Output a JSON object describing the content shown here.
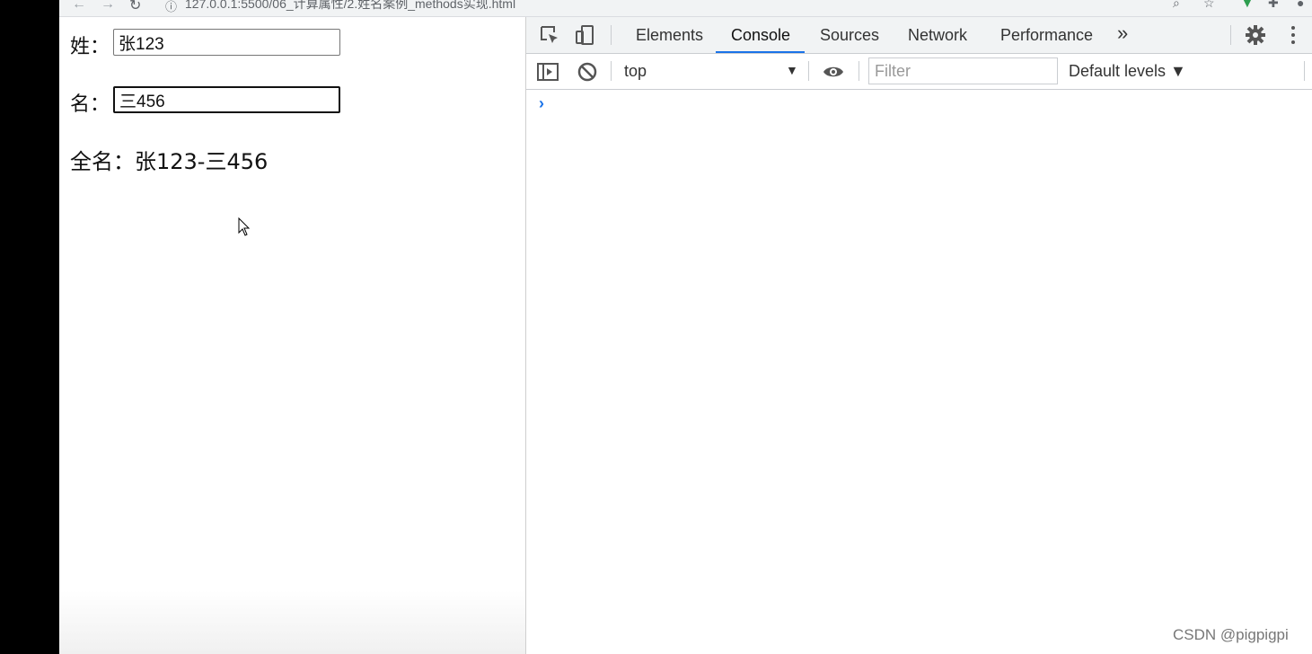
{
  "browser": {
    "url": "127.0.0.1:5500/06_计算属性/2.姓名案例_methods实现.html"
  },
  "page": {
    "last_name_label": "姓：",
    "last_name_value": "张123",
    "first_name_label": "名：",
    "first_name_value": "三456",
    "full_name_text": "全名：张123-三456"
  },
  "devtools": {
    "tabs": [
      "Elements",
      "Console",
      "Sources",
      "Network",
      "Performance"
    ],
    "active_tab": "Console",
    "more_tabs": "»",
    "context": "top",
    "filter_placeholder": "Filter",
    "levels": "Default levels ▼",
    "prompt_symbol": "›"
  },
  "watermark": "CSDN @pigpigpi",
  "colors": {
    "accent": "#1a73e8"
  }
}
